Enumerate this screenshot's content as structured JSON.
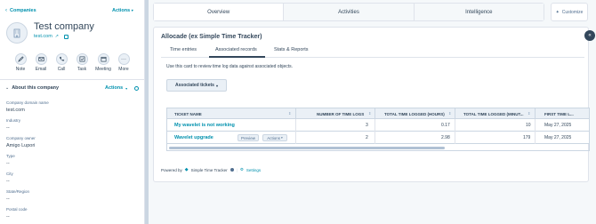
{
  "sidebar": {
    "back_label": "Companies",
    "actions_label": "Actions",
    "company_name": "Test company",
    "company_domain": "test.com",
    "quick_actions": [
      {
        "label": "Note",
        "icon": "note-icon"
      },
      {
        "label": "Email",
        "icon": "email-icon"
      },
      {
        "label": "Call",
        "icon": "call-icon"
      },
      {
        "label": "Task",
        "icon": "task-icon"
      },
      {
        "label": "Meeting",
        "icon": "meeting-icon"
      },
      {
        "label": "More",
        "icon": "more-icon"
      }
    ],
    "about_title": "About this company",
    "about_actions_label": "Actions",
    "properties": [
      {
        "label": "Company domain name",
        "value": "test.com"
      },
      {
        "label": "Industry",
        "value": "--"
      },
      {
        "label": "Company owner",
        "value": "Amigo Lupori"
      },
      {
        "label": "Type",
        "value": "--"
      },
      {
        "label": "City",
        "value": "--"
      },
      {
        "label": "State/Region",
        "value": "--"
      },
      {
        "label": "Postal code",
        "value": "--"
      }
    ]
  },
  "main_tabs": [
    "Overview",
    "Activities",
    "Intelligence"
  ],
  "customize_label": "Customize",
  "card": {
    "title": "Allocade (ex Simple Time Tracker)",
    "subtabs": [
      "Time entries",
      "Associated records",
      "Stats & Reports"
    ],
    "description": "Use this card to review time log data against associated objects.",
    "dropdown_label": "Associated tickets",
    "columns": [
      "TICKET NAME",
      "NUMBER OF TIME LOGS",
      "TOTAL TIME LOGGED (HOURS)",
      "TOTAL TIME LOGGED (MINUT...",
      "FIRST TIME L..."
    ],
    "rows": [
      {
        "name": "My wavelet is not working",
        "logs": "3",
        "hours": "0.17",
        "minutes": "10",
        "first": "May 27, 2025"
      },
      {
        "name": "Wavelet upgrade",
        "logs": "2",
        "hours": "2.98",
        "minutes": "179",
        "first": "May 27, 2025"
      }
    ],
    "row_preview_label": "Preview",
    "row_actions_label": "Actions",
    "powered_by": "Powered by",
    "powered_brand": "Simple Time Tracker",
    "settings_label": "Settings"
  },
  "colors": {
    "accent": "#0091ae",
    "border": "#dfe3eb",
    "text": "#33475b"
  }
}
